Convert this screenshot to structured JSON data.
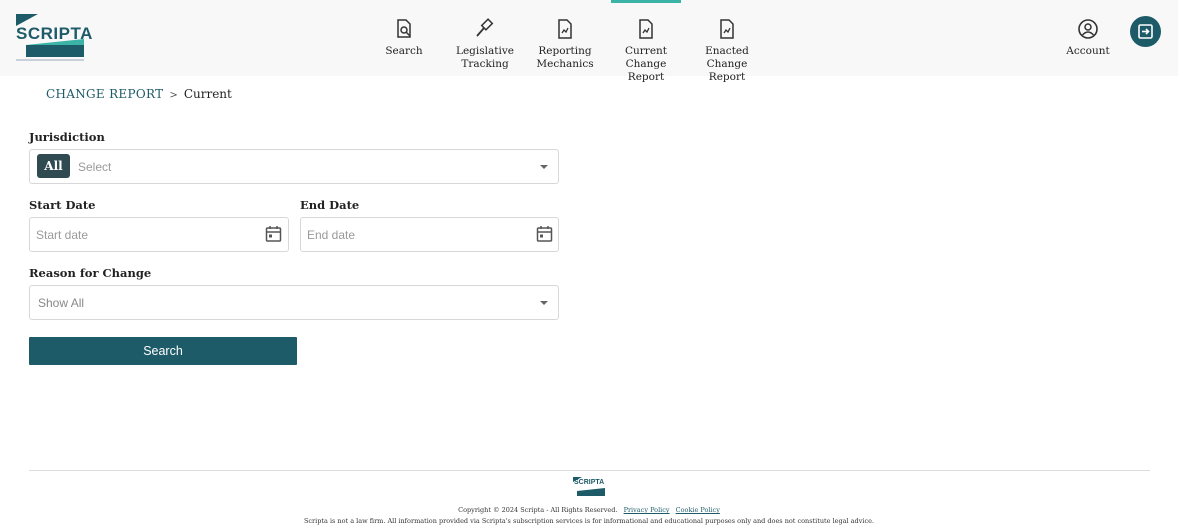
{
  "header": {
    "logo_text": "SCRIPTA",
    "nav": [
      {
        "label": "Search",
        "icon": "document-search-icon"
      },
      {
        "label": "Legislative Tracking",
        "icon": "gavel-icon"
      },
      {
        "label": "Reporting Mechanics",
        "icon": "document-chart-icon"
      },
      {
        "label": "Current Change Report",
        "icon": "document-chart-icon",
        "active": true
      },
      {
        "label": "Enacted Change Report",
        "icon": "document-chart-icon"
      },
      {
        "label": "Account",
        "icon": "account-circle-icon"
      }
    ],
    "nav_lines": {
      "search": [
        "Search"
      ],
      "legislative": [
        "Legislative",
        "Tracking"
      ],
      "reporting": [
        "Reporting",
        "Mechanics"
      ],
      "current": [
        "Current",
        "Change Report"
      ],
      "enacted": [
        "Enacted",
        "Change Report"
      ],
      "account": [
        "Account"
      ]
    },
    "logout_icon": "logout-icon"
  },
  "breadcrumb": {
    "parent": "CHANGE REPORT",
    "separator": ">",
    "current": "Current"
  },
  "form": {
    "jurisdiction": {
      "label": "Jurisdiction",
      "chip": "All",
      "placeholder": "Select"
    },
    "start_date": {
      "label": "Start Date",
      "placeholder": "Start date"
    },
    "end_date": {
      "label": "End Date",
      "placeholder": "End date"
    },
    "reason": {
      "label": "Reason for Change",
      "value": "Show All"
    },
    "search_button": "Search"
  },
  "footer": {
    "logo_text": "SCRIPTA",
    "copyright": "Copyright © 2024 Scripta - All Rights Reserved.",
    "privacy_link": "Privacy Policy",
    "cookie_link": "Cookie Policy",
    "disclaimer": "Scripta is not a law firm. All information provided via Scripta's subscription services is for informational and educational purposes only and does not constitute legal advice."
  },
  "colors": {
    "accent": "#1e5b68",
    "active_bar": "#3bb3a6",
    "chip": "#2f4a50"
  }
}
